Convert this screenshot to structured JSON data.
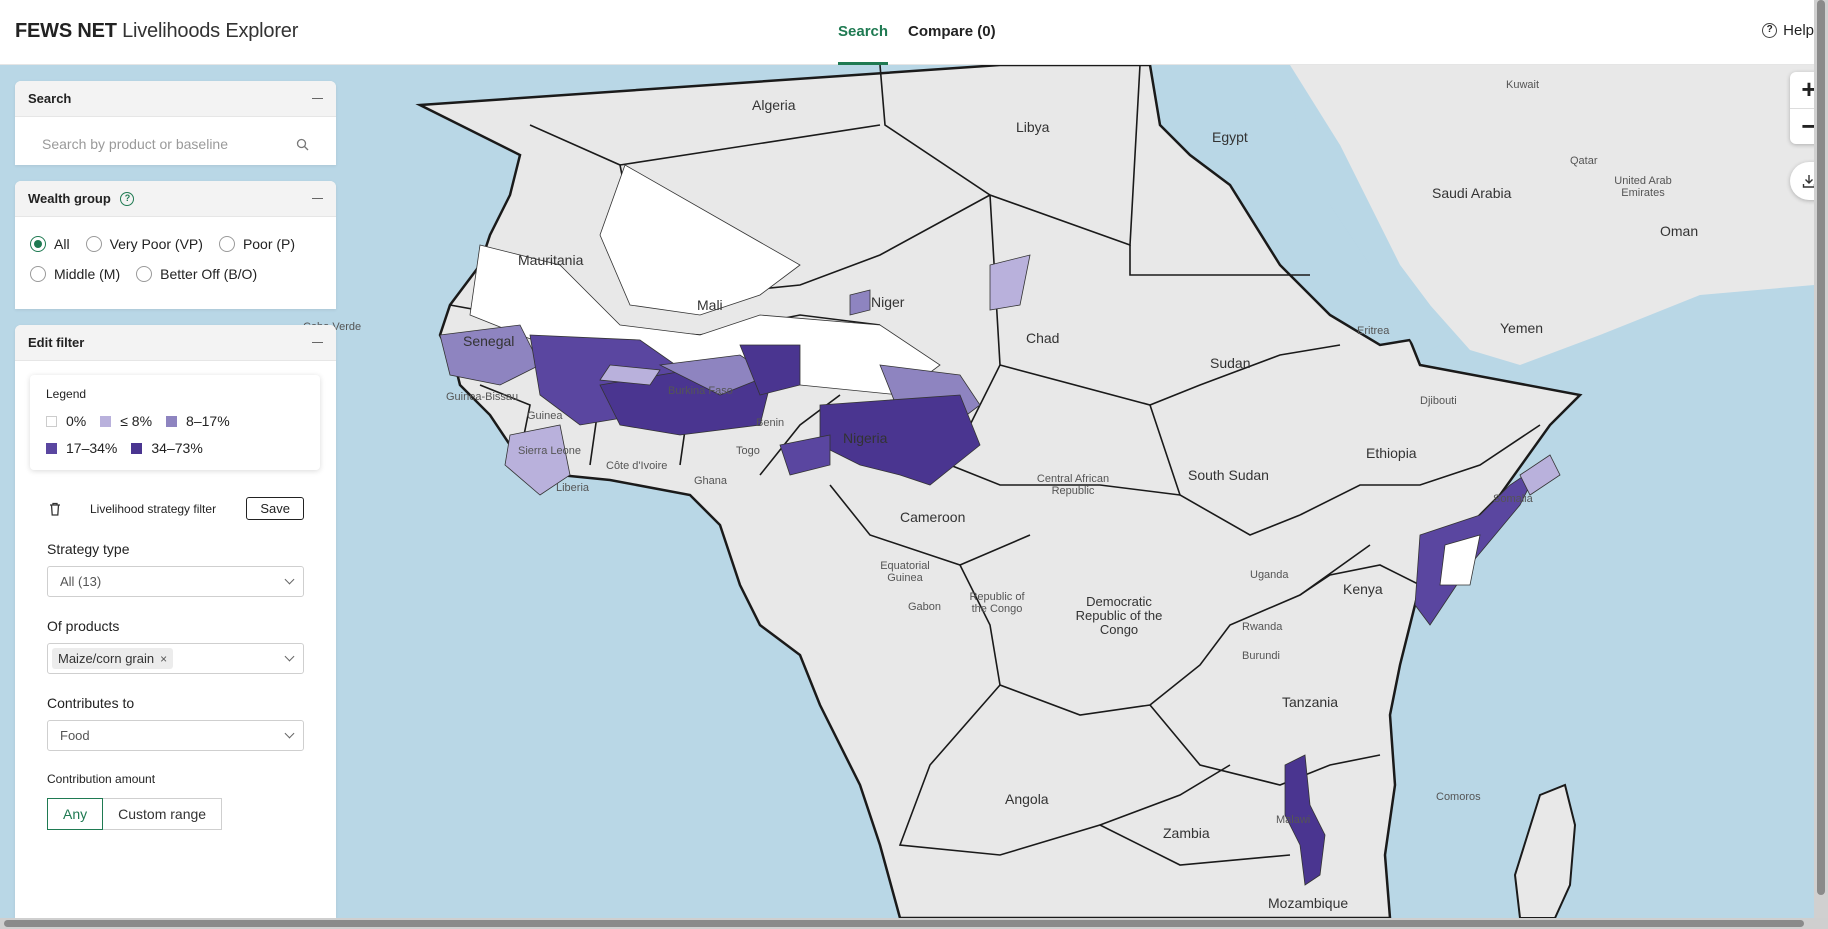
{
  "header": {
    "brand_bold": "FEWS NET",
    "brand_light": "Livelihoods Explorer",
    "tabs": [
      {
        "label": "Search",
        "active": true
      },
      {
        "label": "Compare (0)",
        "active": false
      }
    ],
    "help_label": "Help"
  },
  "search_panel": {
    "title": "Search",
    "placeholder": "Search by product or baseline"
  },
  "wealth_panel": {
    "title": "Wealth group",
    "options": [
      {
        "label": "All",
        "selected": true
      },
      {
        "label": "Very Poor (VP)",
        "selected": false
      },
      {
        "label": "Poor (P)",
        "selected": false
      },
      {
        "label": "Middle (M)",
        "selected": false
      },
      {
        "label": "Better Off (B/O)",
        "selected": false
      }
    ]
  },
  "filter_panel": {
    "title": "Edit filter",
    "legend": {
      "title": "Legend",
      "items": [
        {
          "label": "0%",
          "color": "#ffffff"
        },
        {
          "label": "≤ 8%",
          "color": "#b9b1dc"
        },
        {
          "label": "8–17%",
          "color": "#8e84c0"
        },
        {
          "label": "17–34%",
          "color": "#5a46a0"
        },
        {
          "label": "34–73%",
          "color": "#4a3590"
        }
      ]
    },
    "strategy_filter_label": "Livelihood strategy filter",
    "save_label": "Save",
    "strategy_type_label": "Strategy type",
    "strategy_type_value": "All (13)",
    "products_label": "Of products",
    "product_chip": "Maize/corn grain",
    "contributes_label": "Contributes to",
    "contributes_value": "Food",
    "amount_label": "Contribution amount",
    "amount_options": [
      {
        "label": "Any",
        "selected": true
      },
      {
        "label": "Custom range",
        "selected": false
      }
    ]
  },
  "map": {
    "colors": {
      "water": "#b9d7e6",
      "land": "#e8e8e8",
      "border": "#1a1a1a"
    },
    "countries": [
      "Algeria",
      "Libya",
      "Egypt",
      "Kuwait",
      "Qatar",
      "United Arab Emirates",
      "Saudi Arabia",
      "Oman",
      "Mauritania",
      "Mali",
      "Niger",
      "Chad",
      "Sudan",
      "Eritrea",
      "Yemen",
      "Senegal",
      "Cabo Verde",
      "Guinea-Bissau",
      "Guinea",
      "Burkina Faso",
      "Benin",
      "Nigeria",
      "Djibouti",
      "Ethiopia",
      "Sierra Leone",
      "Liberia",
      "Côte d'Ivoire",
      "Ghana",
      "Togo",
      "Central African Republic",
      "South Sudan",
      "Somalia",
      "Cameroon",
      "Equatorial Guinea",
      "Gabon",
      "Republic of the Congo",
      "Democratic Republic of the Congo",
      "Uganda",
      "Kenya",
      "Rwanda",
      "Burundi",
      "Tanzania",
      "Angola",
      "Zambia",
      "Malawi",
      "Comoros",
      "Mozambique"
    ]
  },
  "map_controls": {
    "zoom_in": "+",
    "zoom_out": "−"
  }
}
